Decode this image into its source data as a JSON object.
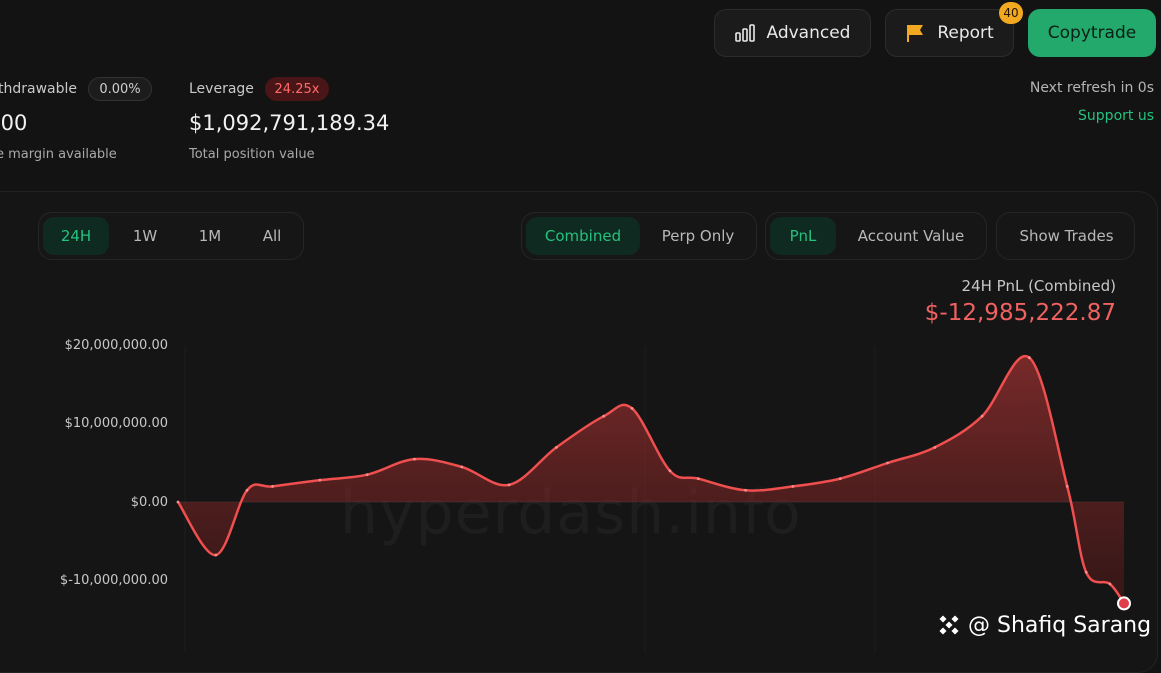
{
  "header": {
    "advanced_label": "Advanced",
    "report_label": "Report",
    "report_badge": "40",
    "copytrade_label": "Copytrade",
    "refresh_text": "Next refresh in 0s",
    "support_text": "Support us"
  },
  "stats": {
    "withdrawable": {
      "label": "thdrawable",
      "pill": "0.00%",
      "value": ".00",
      "sub": "e margin available"
    },
    "leverage": {
      "label": "Leverage",
      "pill": "24.25x",
      "value": "$1,092,791,189.34",
      "sub": "Total position value"
    }
  },
  "controls": {
    "timeframes": [
      "24H",
      "1W",
      "1M",
      "All"
    ],
    "active_timeframe": "24H",
    "scope": [
      "Combined",
      "Perp Only"
    ],
    "active_scope": "Combined",
    "metric": [
      "PnL",
      "Account Value"
    ],
    "active_metric": "PnL",
    "show_trades_label": "Show Trades"
  },
  "pnl_summary": {
    "label": "24H PnL (Combined)",
    "value": "$-12,985,222.87"
  },
  "watermark": "hyperdash.info",
  "attribution": "@ Shafiq Sarang",
  "colors": {
    "accent_green": "#25c27d",
    "loss_red": "#ef4f4f",
    "badge_orange": "#f2a91f"
  },
  "chart_data": {
    "type": "area",
    "y_ticks": [
      "$20,000,000.00",
      "$10,000,000.00",
      "$0.00",
      "$-10,000,000.00"
    ],
    "ylim": [
      -14000000,
      20000000
    ],
    "x": [
      0,
      0.04,
      0.073,
      0.1,
      0.15,
      0.2,
      0.25,
      0.3,
      0.35,
      0.4,
      0.45,
      0.48,
      0.52,
      0.55,
      0.6,
      0.65,
      0.7,
      0.75,
      0.8,
      0.85,
      0.9,
      0.94,
      0.96,
      0.985,
      1.0
    ],
    "values": [
      0,
      -6800000,
      1500000,
      2000000,
      2800000,
      3500000,
      5500000,
      4500000,
      2200000,
      7000000,
      11000000,
      12000000,
      4000000,
      3000000,
      1500000,
      2000000,
      3000000,
      5000000,
      7000000,
      11000000,
      18500000,
      2000000,
      -9000000,
      -10500000,
      -13000000
    ]
  }
}
